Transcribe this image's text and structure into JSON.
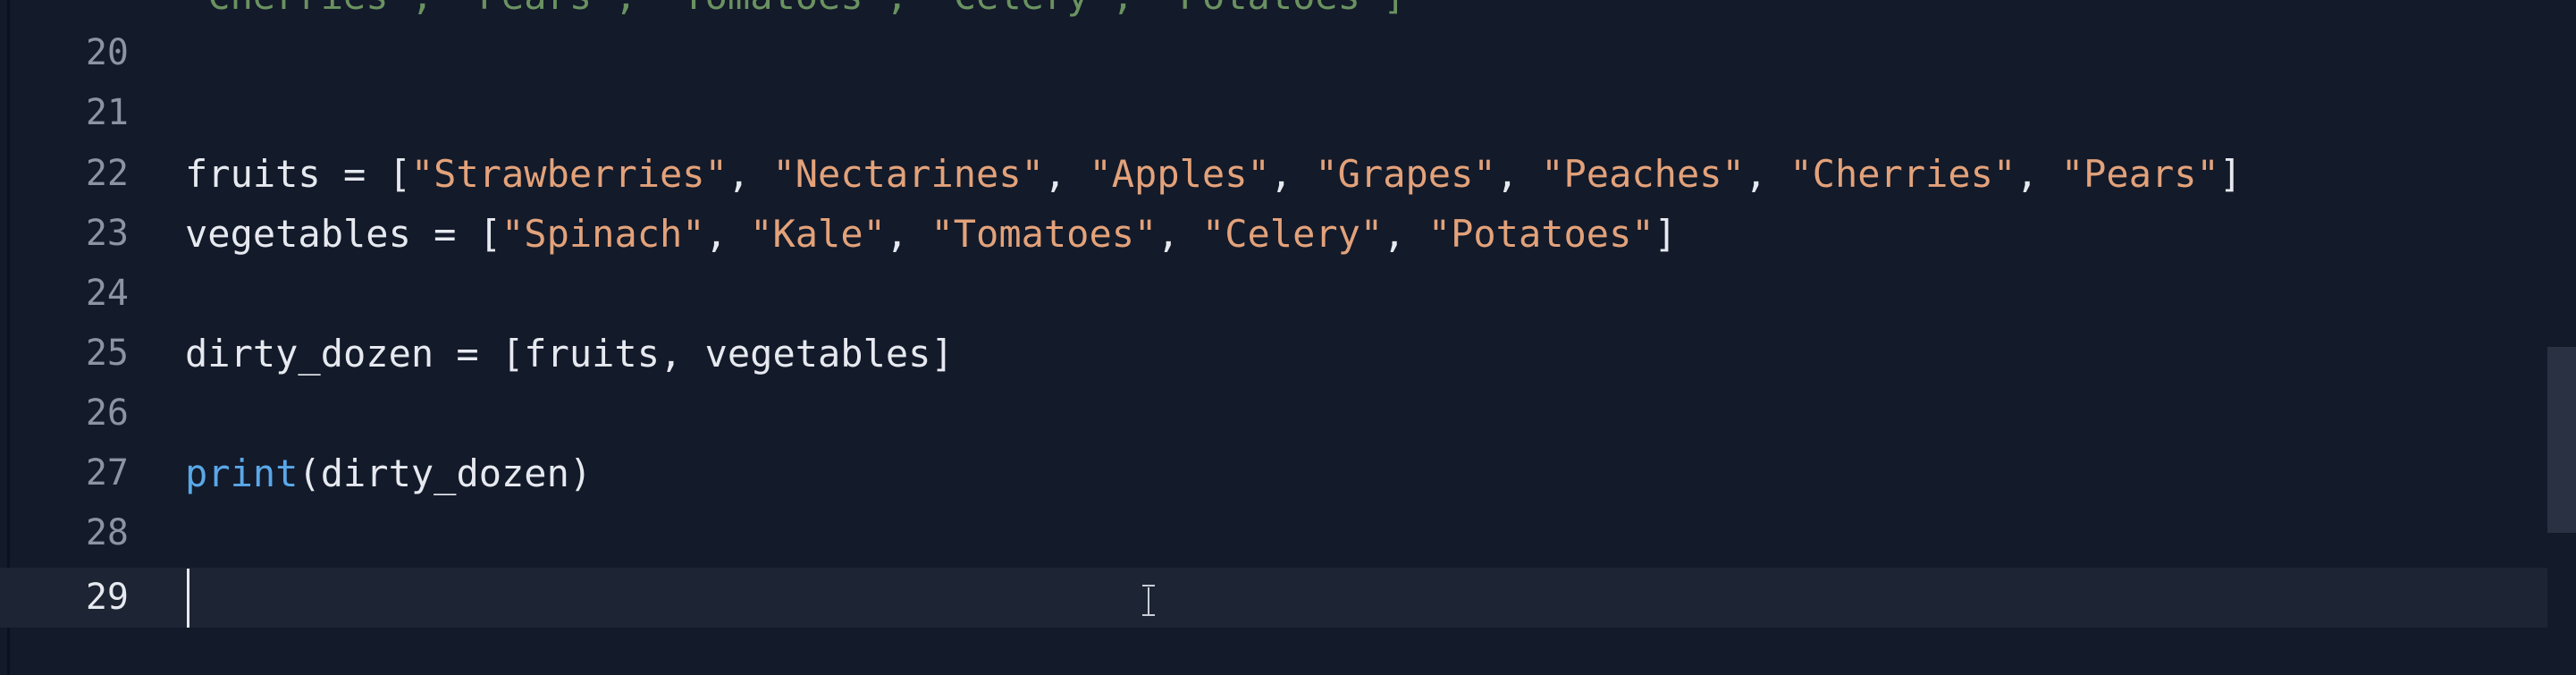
{
  "editor": {
    "partial_top_line": {
      "t1": "\"Cherries\"",
      "t2": ", ",
      "t3": "\"Pears\"",
      "t4": ", ",
      "t5": "\"Tomatoes\"",
      "t6": ", ",
      "t7": "\"Celery\"",
      "t8": ", ",
      "t9": "\"Potatoes\"",
      "t10": "]"
    },
    "line_numbers": [
      "20",
      "21",
      "22",
      "23",
      "24",
      "25",
      "26",
      "27",
      "28",
      "29"
    ],
    "line22": {
      "t1": "fruits = [",
      "t2": "\"Strawberries\"",
      "t3": ", ",
      "t4": "\"Nectarines\"",
      "t5": ", ",
      "t6": "\"Apples\"",
      "t7": ", ",
      "t8": "\"Grapes\"",
      "t9": ", ",
      "t10": "\"Peaches\"",
      "t11": ", ",
      "t12": "\"Cherries\"",
      "t13": ", ",
      "t14": "\"Pears\"",
      "t15": "]"
    },
    "line23": {
      "t1": "vegetables = [",
      "t2": "\"Spinach\"",
      "t3": ", ",
      "t4": "\"Kale\"",
      "t5": ", ",
      "t6": "\"Tomatoes\"",
      "t7": ", ",
      "t8": "\"Celery\"",
      "t9": ", ",
      "t10": "\"Potatoes\"",
      "t11": "]"
    },
    "line25": {
      "t1": "dirty_dozen = [fruits, vegetables]"
    },
    "line27": {
      "t1": "print",
      "t2": "(dirty_dozen)"
    },
    "current_line": "29",
    "colors": {
      "background": "#131a2a",
      "current_line": "#1d2434",
      "string": "#e3a27a",
      "builtin": "#5aa8e8",
      "text": "#e6e9ef",
      "line_number": "#8b93a4"
    }
  }
}
